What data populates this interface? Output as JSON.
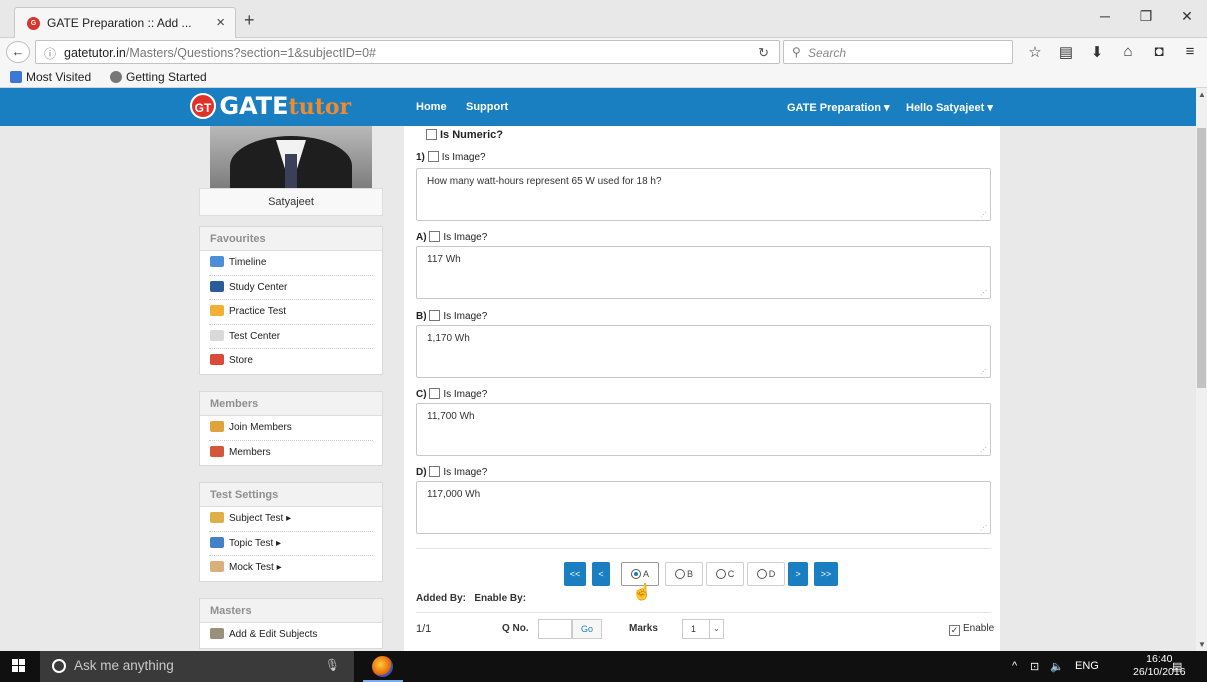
{
  "browser": {
    "tab_title": "GATE Preparation :: Add ...",
    "tab_favicon_text": "G",
    "new_tab_symbol": "+",
    "close_symbol": "×",
    "url_host": "gatetutor.in",
    "url_path": "/Masters/Questions?section=1&subjectID=0#",
    "search_placeholder": "Search",
    "bookmarks": [
      "Most Visited",
      "Getting Started"
    ]
  },
  "site_header": {
    "logo_badge": "GT",
    "logo_part1": "GATE",
    "logo_part2": "tutor",
    "nav": [
      "Home",
      "Support"
    ],
    "right_nav": [
      "GATE Preparation ▾",
      "Hello Satyajeet ▾"
    ]
  },
  "sidebar": {
    "profile_name": "Satyajeet",
    "panels": [
      {
        "title": "Favourites",
        "items": [
          "Timeline",
          "Study Center",
          "Practice Test",
          "Test Center",
          "Store"
        ]
      },
      {
        "title": "Members",
        "items": [
          "Join Members",
          "Members"
        ]
      },
      {
        "title": "Test Settings",
        "items": [
          "Subject Test ▸",
          "Topic Test ▸",
          "Mock Test ▸"
        ]
      },
      {
        "title": "Masters",
        "items": [
          "Add & Edit Subjects"
        ]
      }
    ]
  },
  "form": {
    "is_numeric_label": "Is Numeric?",
    "is_image_label": "Is Image?",
    "question_prefix": "1)",
    "question_text": "How many watt-hours represent 65 W used for 18 h?",
    "options": [
      {
        "prefix": "A)",
        "value": "117 Wh"
      },
      {
        "prefix": "B)",
        "value": "1,170 Wh"
      },
      {
        "prefix": "C)",
        "value": "11,700 Wh"
      },
      {
        "prefix": "D)",
        "value": "117,000 Wh"
      }
    ],
    "pager": {
      "first": "<<",
      "prev": "<",
      "next": ">",
      "last": ">>",
      "choices": [
        "A",
        "B",
        "C",
        "D"
      ],
      "selected": "A"
    },
    "added_by_label": "Added By:",
    "enable_by_label": "Enable By:",
    "page_counter": "1/1",
    "qno_label": "Q No.",
    "go_label": "Go",
    "marks_label": "Marks",
    "marks_value": "1",
    "enable_label": "Enable"
  },
  "taskbar": {
    "search_placeholder": "Ask me anything",
    "language": "ENG",
    "time": "16:40",
    "date": "26/10/2016"
  }
}
